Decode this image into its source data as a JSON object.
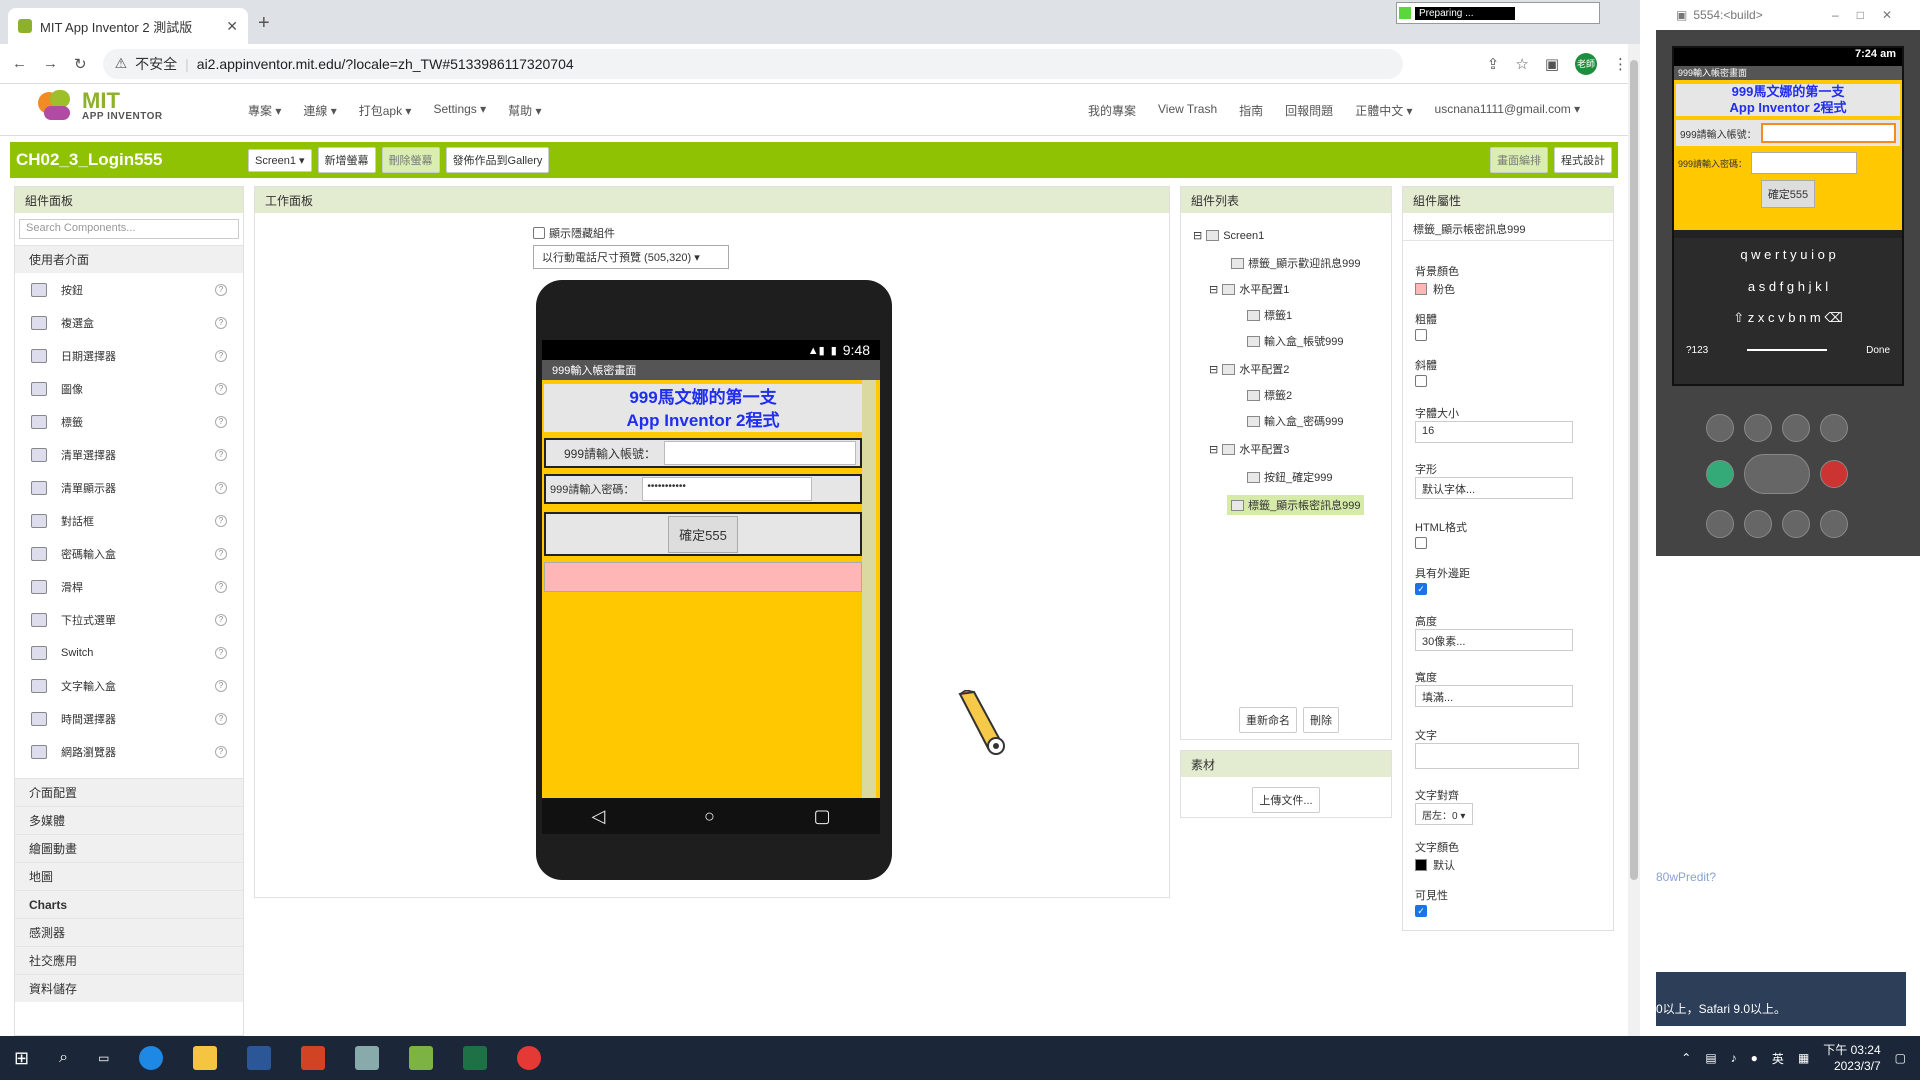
{
  "browser": {
    "tab_title": "MIT App Inventor 2 測試版",
    "new_tab": "+",
    "insecure_label": "不安全",
    "url": "ai2.appinventor.mit.edu/?locale=zh_TW#5133986117320704",
    "profile": "老師"
  },
  "preparing": {
    "text": "Preparing ..."
  },
  "logo": {
    "line1": "MIT",
    "line2": "APP INVENTOR"
  },
  "menu_left": [
    "專案 ▾",
    "連線 ▾",
    "打包apk ▾",
    "Settings ▾",
    "幫助 ▾"
  ],
  "menu_right": [
    "我的專案",
    "View Trash",
    "指南",
    "回報問題",
    "正體中文 ▾",
    "uscnana1111@gmail.com ▾"
  ],
  "toolbar": {
    "project": "CH02_3_Login555",
    "screen": "Screen1 ▾",
    "add_screen": "新增螢幕",
    "remove_screen": "刪除螢幕",
    "publish": "發佈作品到Gallery",
    "designer": "畫面編排",
    "blocks": "程式設計"
  },
  "palette": {
    "title": "組件面板",
    "search_placeholder": "Search Components...",
    "category": "使用者介面",
    "items": [
      "按鈕",
      "複選盒",
      "日期選擇器",
      "圖像",
      "標籤",
      "清單選擇器",
      "清單顯示器",
      "對話框",
      "密碼輸入盒",
      "滑桿",
      "下拉式選單",
      "Switch",
      "文字輸入盒",
      "時間選擇器",
      "網路瀏覽器"
    ],
    "categories": [
      "介面配置",
      "多媒體",
      "繪圖動畫",
      "地圖",
      "Charts",
      "感測器",
      "社交應用",
      "資料儲存"
    ]
  },
  "viewer": {
    "title": "工作面板",
    "show_hidden": "顯示隱藏組件",
    "size_select": "以行動電話尺寸預覽 (505,320) ▾"
  },
  "phone": {
    "time": "9:48",
    "app_title": "999輸入帳密畫面",
    "title_line1": "999馬文娜的第一支",
    "title_line2": "App Inventor 2程式",
    "account_label": "999請輸入帳號：",
    "password_label": "999請輸入密碼：",
    "password_value": "•••••••••••",
    "button": "確定555",
    "nav_back": "◁",
    "nav_home": "○",
    "nav_recent": "▢"
  },
  "tree": {
    "title": "組件列表",
    "nodes": [
      "Screen1",
      "標籤_顯示歡迎訊息999",
      "水平配置1",
      "標籤1",
      "輸入盒_帳號999",
      "水平配置2",
      "標籤2",
      "輸入盒_密碼999",
      "水平配置3",
      "按鈕_確定999",
      "標籤_顯示帳密訊息999"
    ],
    "rename": "重新命名",
    "delete": "刪除"
  },
  "media": {
    "title": "素材",
    "upload": "上傳文件..."
  },
  "props": {
    "title": "組件屬性",
    "component": "標籤_顯示帳密訊息999",
    "bg_label": "背景顏色",
    "bg_value": "粉色",
    "bold_label": "粗體",
    "italic_label": "斜體",
    "fontsize_label": "字體大小",
    "fontsize_value": "16",
    "font_label": "字形",
    "font_value": "默认字体...",
    "html_label": "HTML格式",
    "margin_label": "具有外邊距",
    "height_label": "高度",
    "height_value": "30像素...",
    "width_label": "寬度",
    "width_value": "填滿...",
    "text_label": "文字",
    "align_label": "文字對齊",
    "align_value": "居左：0 ▾",
    "color_label": "文字顏色",
    "color_value": "默认",
    "visible_label": "可見性"
  },
  "emulator": {
    "window_title": "5554:<build>",
    "time": "7:24 am",
    "app_title": "999輸入帳密畫面",
    "title_line1": "999馬文娜的第一支",
    "title_line2": "App Inventor 2程式",
    "account_label": "999請輸入帳號：",
    "password_label": "999請輸入密碼：",
    "button": "確定555",
    "row1": "q w e r t y u i o p",
    "row2": "a s d f g h j k l",
    "row3": "⇧ z x c v b n m ⌫",
    "row4_left": "?123",
    "row4_right": "Done"
  },
  "side_text": {
    "link": "80wPredit?",
    "note": "0以上，Safari 9.0以上。"
  },
  "taskbar": {
    "time": "下午 03:24",
    "date": "2023/3/7",
    "ime": "英"
  }
}
